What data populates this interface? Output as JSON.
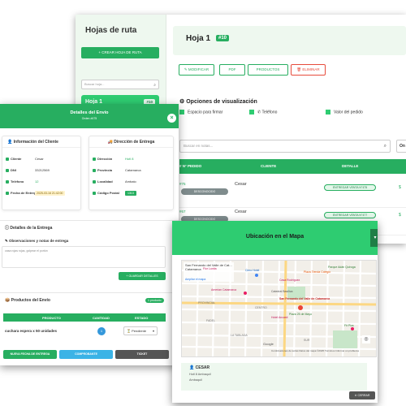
{
  "sidebar": {
    "title": "Hojas de ruta",
    "create_button": "+ CREAR HOJA DE RUTA",
    "search_placeholder": "Buscar hoja...",
    "route_label": "Hoja 1",
    "route_badge": "#10"
  },
  "header": {
    "title": "Hoja 1",
    "id_badge": "#10"
  },
  "actions": {
    "modify": "✎ MODIFICAR",
    "pdf": "PDF",
    "products": "PRODUCTOS",
    "delete": "🗑 ELIMINAR"
  },
  "visualization": {
    "title": "Opciones de visualización",
    "options": [
      "Espacio para firmar",
      "Teléfono",
      "Valor del pedido"
    ]
  },
  "orders_search": {
    "placeholder": "Buscar en notas...",
    "right_label": "On"
  },
  "orders_table": {
    "columns": [
      "# N° PEDIDO",
      "CLIENTE",
      "DETALLE"
    ],
    "rows": [
      {
        "number": "#75",
        "status": "DESCONOCIDO",
        "client": "Cesar",
        "action": "ENTREGAR VENTA N°475",
        "price": "$"
      },
      {
        "number": "#67",
        "status": "DESCONOCIDO",
        "client": "Cesar",
        "action": "ENTREGAR VENTA N°477",
        "price": "$"
      }
    ]
  },
  "details_modal": {
    "title": "Detalles del Envío",
    "subtitle": "Orden #475",
    "client_card": {
      "title": "Información del Cliente",
      "fields": [
        {
          "label": "Cliente",
          "value": "Cesar"
        },
        {
          "label": "DNI",
          "value": "33212569"
        },
        {
          "label": "Teléfono",
          "value": "12"
        },
        {
          "label": "Fecha de Entrega",
          "value": "2025-03-16 21:42:00"
        }
      ]
    },
    "delivery_card": {
      "title": "Dirección de Entrega",
      "fields": [
        {
          "label": "Dirección",
          "value": "Hotl 8"
        },
        {
          "label": "Provincia",
          "value": "Catamarca"
        },
        {
          "label": "Localidad",
          "value": "Ambato"
        },
        {
          "label": "Código Postal",
          "value": "1313"
        }
      ]
    },
    "delivery_details": {
      "title": "Detalles de la Entrega",
      "notes_label": "Observaciones y notas de entrega",
      "notes_value": "casa rojas rojas, golpear el portón",
      "save_button": "+ GUARDAR DETALLES"
    },
    "products": {
      "title": "Productos del Envío",
      "count_badge": "1 producto",
      "columns": [
        "PRODUCTO",
        "CANTIDAD",
        "ESTADO"
      ],
      "rows": [
        {
          "name": "cuchara espera x 50 unidades",
          "qty": "1",
          "state": "Pendiente"
        }
      ]
    },
    "buttons": {
      "new_date": "NUEVA FECHA DE ENTREGA",
      "receipt": "COMPROBANTE",
      "ticket": "TICKET"
    }
  },
  "map_modal": {
    "title": "Ubicación en el Mapa",
    "map_place": "San Fernando del Valle de Cat...",
    "map_place_sub": "Catamarca",
    "map_link": "Ampliar el mapa",
    "map_footer": "Combinaciones de teclas   Datos del mapa ©2025   Términos   Informar un problema",
    "labels": [
      "Catedral Basílica",
      "San Fernando del Valle de Catamarca",
      "Plaza 25 de Mayo",
      "Parque Adán Quiroga",
      "Flor Lunita",
      "Casa Rodríguez",
      "Hotel Ancasti",
      "Cimo Hotel",
      "Plaza Tienda Colegio",
      "Amerian Catamarca",
      "PROVINCIAL",
      "CENTRO",
      "FADEL",
      "SUR",
      "LA TABLADA",
      "Google",
      "Fit Plus"
    ],
    "client_name": "CESAR",
    "address_line1": "Hotl 8 Ambaquil",
    "address_line2": "Ambaquil",
    "close_button": "✕ CERRAR"
  },
  "colors": {
    "accent": "#27ae60",
    "accent_light": "#2ecc71",
    "danger": "#e74c3c",
    "info": "#3498db"
  }
}
